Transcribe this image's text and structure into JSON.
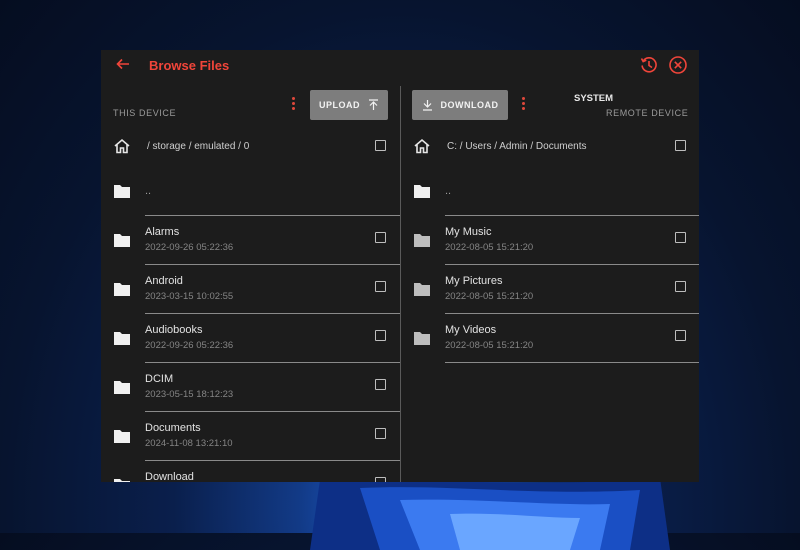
{
  "app": {
    "title": "Browse Files"
  },
  "local": {
    "label": "THIS DEVICE",
    "upload_label": "UPLOAD",
    "path": "/ storage / emulated / 0",
    "parent": "..",
    "items": [
      {
        "name": "Alarms",
        "date": "2022-09-26 05:22:36"
      },
      {
        "name": "Android",
        "date": "2023-03-15 10:02:55"
      },
      {
        "name": "Audiobooks",
        "date": "2022-09-26 05:22:36"
      },
      {
        "name": "DCIM",
        "date": "2023-05-15 18:12:23"
      },
      {
        "name": "Documents",
        "date": "2024-11-08 13:21:10"
      },
      {
        "name": "Download",
        "date": ""
      }
    ]
  },
  "remote": {
    "device_name": "SYSTEM",
    "label": "REMOTE DEVICE",
    "download_label": "DOWNLOAD",
    "path": "C: / Users / Admin / Documents",
    "parent": "..",
    "items": [
      {
        "name": "My Music",
        "date": "2022-08-05 15:21:20"
      },
      {
        "name": "My Pictures",
        "date": "2022-08-05 15:21:20"
      },
      {
        "name": "My Videos",
        "date": "2022-08-05 15:21:20"
      }
    ]
  },
  "colors": {
    "accent": "#f0453a",
    "panel": "#1c1c1c",
    "button": "#7d7d7d"
  }
}
